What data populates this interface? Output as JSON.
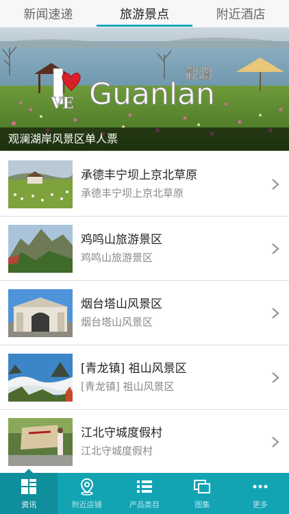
{
  "tabs": [
    {
      "label": "新闻速递",
      "active": false
    },
    {
      "label": "旅游景点",
      "active": true
    },
    {
      "label": "附近酒店",
      "active": false
    }
  ],
  "hero": {
    "caption": "观澜湖岸风景区单人票",
    "logo_text": "Guanlan",
    "logo_heart": "I",
    "logo_ve": "VE",
    "logo_cn": "觀瀾"
  },
  "list": [
    {
      "title": "承德丰宁坝上京北草原",
      "subtitle": "承德丰宁坝上京北草原",
      "thumb": "grassland"
    },
    {
      "title": "鸡鸣山旅游景区",
      "subtitle": "鸡鸣山旅游景区",
      "thumb": "mountain"
    },
    {
      "title": "烟台塔山风景区",
      "subtitle": "烟台塔山风景区",
      "thumb": "gate"
    },
    {
      "title": "[青龙镇] 祖山风景区",
      "subtitle": "[青龙镇] 祖山风景区",
      "thumb": "clouds"
    },
    {
      "title": "江北守城度假村",
      "subtitle": "江北守城度假村",
      "thumb": "stone"
    }
  ],
  "bottom_nav": [
    {
      "label": "资讯",
      "icon": "grid-icon",
      "active": true
    },
    {
      "label": "附近店铺",
      "icon": "location-pin-icon",
      "active": false
    },
    {
      "label": "产品类目",
      "icon": "list-icon",
      "active": false
    },
    {
      "label": "图集",
      "icon": "gallery-icon",
      "active": false
    },
    {
      "label": "更多",
      "icon": "more-dots-icon",
      "active": false
    }
  ],
  "colors": {
    "accent": "#13a4b4",
    "accent_dark": "#0f8e9c"
  }
}
